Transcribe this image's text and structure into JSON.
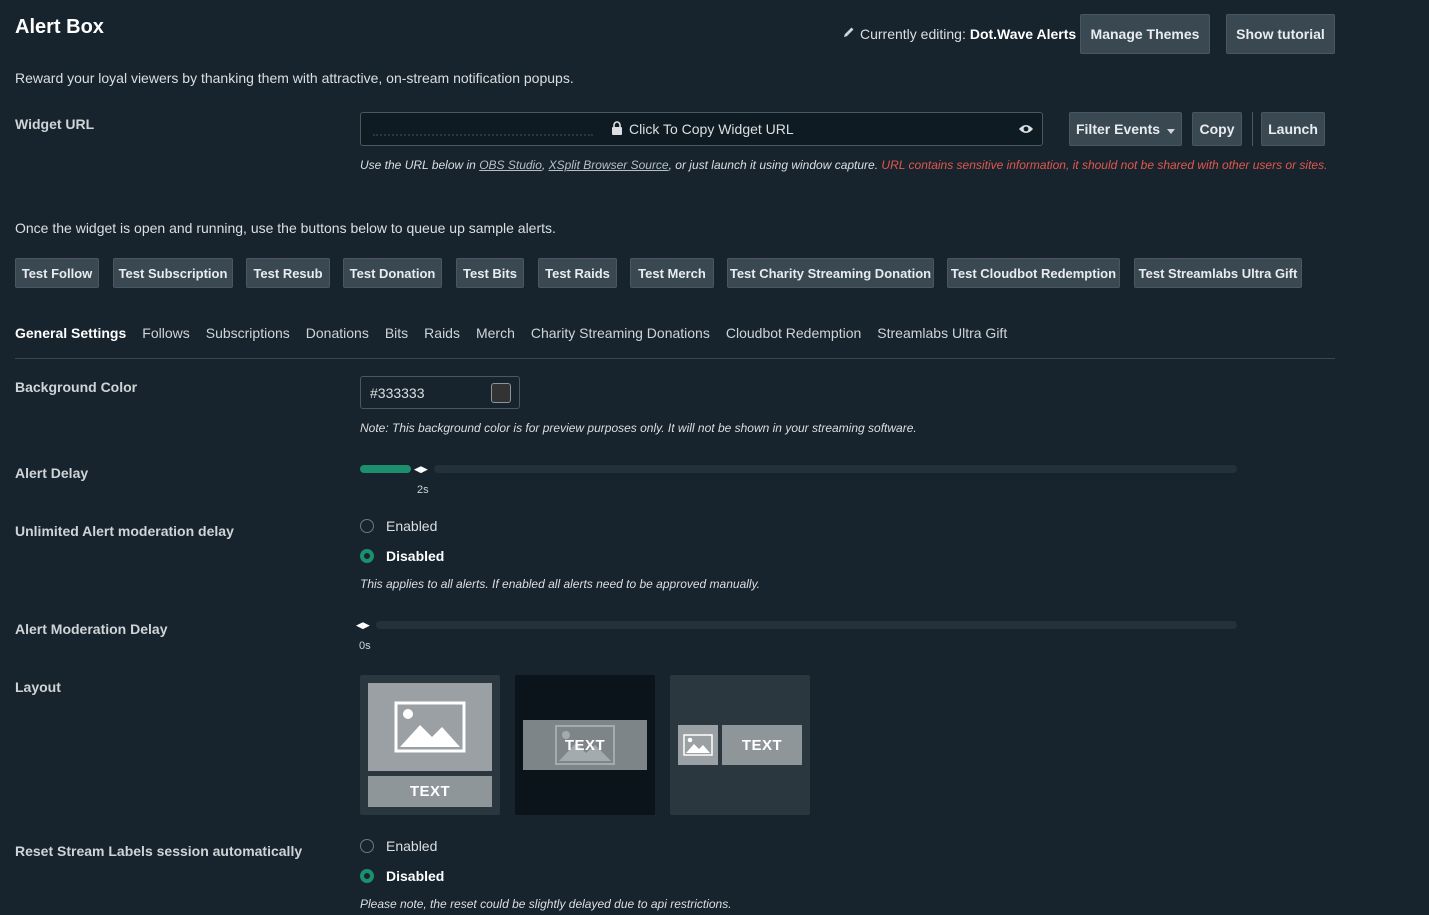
{
  "header": {
    "title": "Alert Box",
    "editing_label": "Currently editing:",
    "editing_theme": "Dot.Wave Alerts",
    "manage_themes": "Manage Themes",
    "show_tutorial": "Show tutorial"
  },
  "description": "Reward your loyal viewers by thanking them with attractive, on-stream notification popups.",
  "widget_url": {
    "label": "Widget URL",
    "copy_text": "Click To Copy Widget URL",
    "filter_events": "Filter Events",
    "copy": "Copy",
    "launch": "Launch",
    "note_prefix": "Use the URL below in",
    "note_obs": "OBS Studio",
    "note_xsplit": "XSplit Browser Source",
    "note_mid": ", or just launch it using window capture.",
    "note_warning": "URL contains sensitive information, it should not be shared with other users or sites."
  },
  "queue_text": "Once the widget is open and running, use the buttons below to queue up sample alerts.",
  "test_buttons": [
    "Test Follow",
    "Test Subscription",
    "Test Resub",
    "Test Donation",
    "Test Bits",
    "Test Raids",
    "Test Merch",
    "Test Charity Streaming Donation",
    "Test Cloudbot Redemption",
    "Test Streamlabs Ultra Gift"
  ],
  "tabs": [
    "General Settings",
    "Follows",
    "Subscriptions",
    "Donations",
    "Bits",
    "Raids",
    "Merch",
    "Charity Streaming Donations",
    "Cloudbot Redemption",
    "Streamlabs Ultra Gift"
  ],
  "settings": {
    "bg_color_label": "Background Color",
    "bg_color_value": "#333333",
    "bg_color_note": "Note: This background color is for preview purposes only. It will not be shown in your streaming software.",
    "alert_delay_label": "Alert Delay",
    "alert_delay_value": "2s",
    "alert_delay_fraction": 0.058,
    "unlimited_label": "Unlimited Alert moderation delay",
    "enabled": "Enabled",
    "disabled": "Disabled",
    "unlimited_note": "This applies to all alerts. If enabled all alerts need to be approved manually.",
    "mod_delay_label": "Alert Moderation Delay",
    "mod_delay_value": "0s",
    "layout_label": "Layout",
    "layout_text": "TEXT",
    "reset_label": "Reset Stream Labels session automatically",
    "reset_note": "Please note, the reset could be slightly delayed due to api restrictions."
  },
  "colors": {
    "accent": "#1b8f6e",
    "warning": "#e2574c",
    "background": "#17242d"
  }
}
